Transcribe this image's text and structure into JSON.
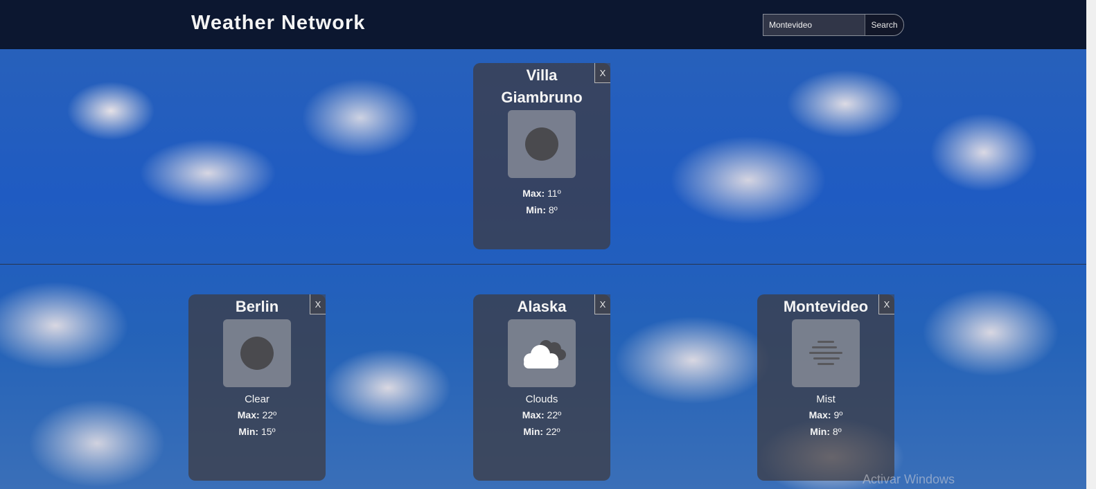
{
  "header": {
    "title": "Weather Network",
    "search_value": "Montevideo",
    "search_button": "Search"
  },
  "cards": [
    {
      "city": "Villa Giambruno",
      "icon": "clear-sun-icon",
      "description": "",
      "max_label": "Max:",
      "max": "11º",
      "min_label": "Min:",
      "min": "8º",
      "close": "X"
    },
    {
      "city": "Berlin",
      "icon": "clear-sun-icon",
      "description": "Clear",
      "max_label": "Max:",
      "max": "22º",
      "min_label": "Min:",
      "min": "15º",
      "close": "X"
    },
    {
      "city": "Alaska",
      "icon": "clouds-icon",
      "description": "Clouds",
      "max_label": "Max:",
      "max": "22º",
      "min_label": "Min:",
      "min": "22º",
      "close": "X"
    },
    {
      "city": "Montevideo",
      "icon": "mist-icon",
      "description": "Mist",
      "max_label": "Max:",
      "max": "9º",
      "min_label": "Min:",
      "min": "8º",
      "close": "X"
    }
  ],
  "watermark": "Activar Windows"
}
